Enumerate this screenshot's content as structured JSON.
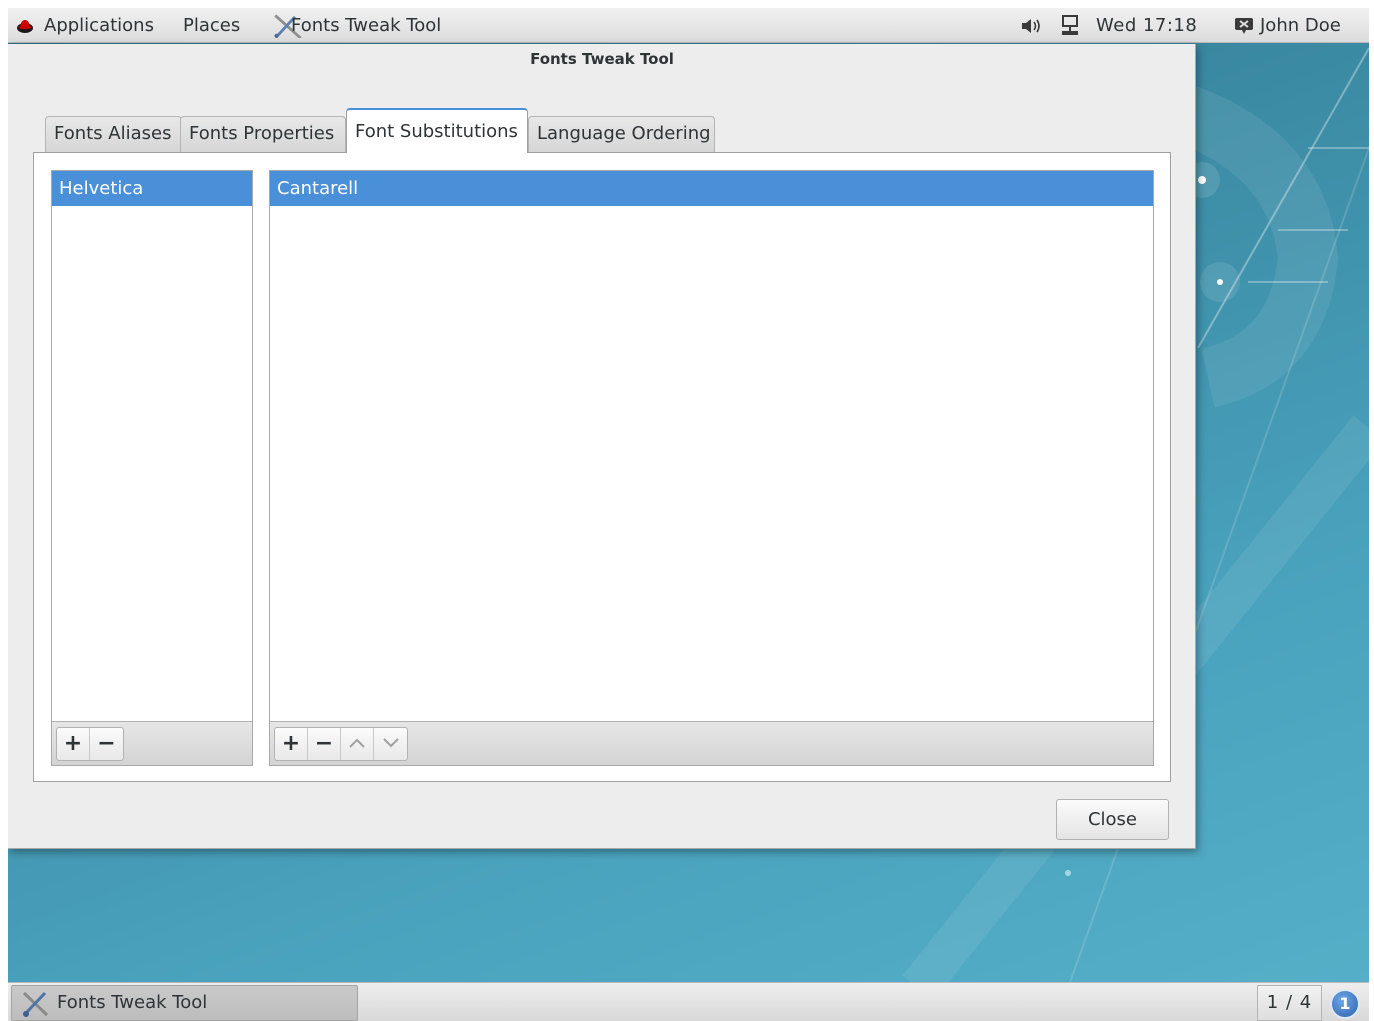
{
  "topbar": {
    "applications_label": "Applications",
    "places_label": "Places",
    "active_app_label": "Fonts Tweak Tool",
    "clock": "Wed 17:18",
    "user_name": "John Doe",
    "icons": [
      "redhat-logo-icon",
      "tools-icon",
      "volume-icon",
      "network-icon",
      "user-icon"
    ]
  },
  "dialog": {
    "title": "Fonts Tweak Tool",
    "tabs": [
      {
        "label": "Fonts Aliases",
        "active": false
      },
      {
        "label": "Fonts Properties",
        "active": false
      },
      {
        "label": "Font Substitutions",
        "active": true
      },
      {
        "label": "Language Ordering",
        "active": false
      }
    ],
    "left_list": {
      "items": [
        {
          "label": "Helvetica",
          "selected": true
        }
      ],
      "toolbar": {
        "add": "+",
        "remove": "−"
      }
    },
    "right_list": {
      "items": [
        {
          "label": "Cantarell",
          "selected": true
        }
      ],
      "toolbar": {
        "add": "+",
        "remove": "−",
        "icons": [
          "move-up-icon",
          "move-down-icon"
        ]
      }
    },
    "close_label": "Close"
  },
  "bottombar": {
    "task_label": "Fonts Tweak Tool",
    "workspace": "1 / 4",
    "notification_count": "1"
  },
  "colors": {
    "selection": "#4a90d9",
    "desktop": "#4aa3be",
    "panel": "#e6e6e6"
  }
}
